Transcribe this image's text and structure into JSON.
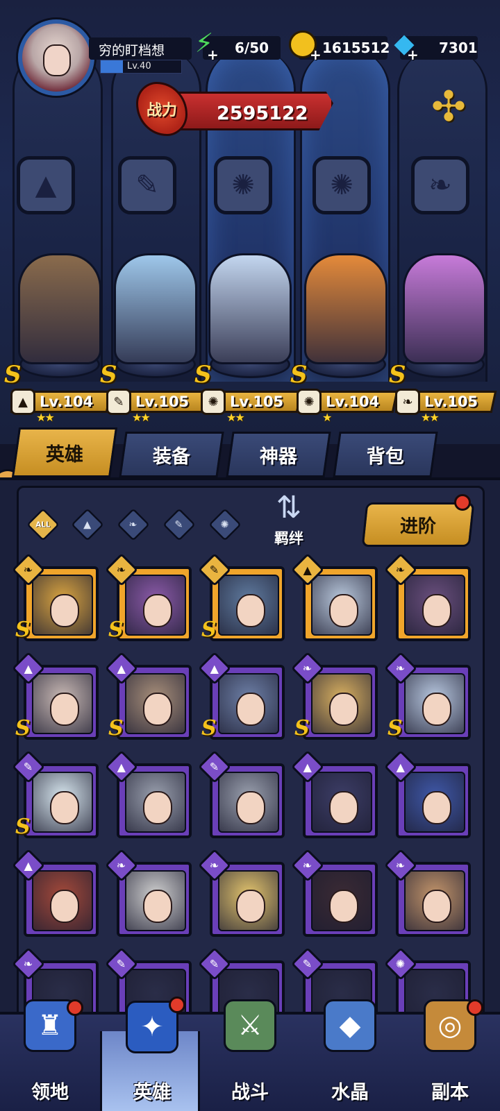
{
  "player": {
    "name": "穷的盯档想",
    "level": "Lv.40",
    "level_progress": 0.28
  },
  "resources": {
    "stamina": "6/50",
    "gold": "1615512",
    "gems": "7301"
  },
  "power": {
    "label": "战力",
    "value": "2595122"
  },
  "lineup": [
    {
      "level": "Lv.104",
      "class_icon": "mage-hat-icon",
      "class_glyph": "▲",
      "stars": "★★",
      "color": "#8a6b4c"
    },
    {
      "level": "Lv.105",
      "class_icon": "wrench-icon",
      "class_glyph": "✎",
      "stars": "★★",
      "color": "#9ec7ea"
    },
    {
      "level": "Lv.105",
      "class_icon": "beast-icon",
      "class_glyph": "✺",
      "stars": "★★",
      "color": "#c3d6ef"
    },
    {
      "level": "Lv.104",
      "class_icon": "beast-icon",
      "class_glyph": "✺",
      "stars": "★",
      "color": "#e48a3a"
    },
    {
      "level": "Lv.105",
      "class_icon": "wing-icon",
      "class_glyph": "❧",
      "stars": "★★",
      "color": "#c77bd9"
    }
  ],
  "tabs": [
    "英雄",
    "装备",
    "神器",
    "背包"
  ],
  "filters": {
    "all_label": "ALL",
    "icons": [
      "mage-hat-icon",
      "wing-icon",
      "wrench-icon",
      "beast-icon"
    ]
  },
  "bond_label": "羁绊",
  "advance_label": "进阶",
  "heroes": [
    {
      "frame": "gold",
      "class": "wing-icon",
      "glyph": "❧",
      "rank": "S",
      "bg": "#d9a441"
    },
    {
      "frame": "gold",
      "class": "wing-icon",
      "glyph": "❧",
      "rank": "S",
      "bg": "#8b5aa8"
    },
    {
      "frame": "gold",
      "class": "wrench-icon",
      "glyph": "✎",
      "rank": "S",
      "bg": "#5f7a9e"
    },
    {
      "frame": "gold",
      "class": "mage-hat-icon",
      "glyph": "▲",
      "rank": "",
      "bg": "#b9c8dc"
    },
    {
      "frame": "gold",
      "class": "wing-icon",
      "glyph": "❧",
      "rank": "",
      "bg": "#6a4f7d"
    },
    {
      "frame": "purple",
      "class": "mage-hat-icon",
      "glyph": "▲",
      "rank": "S",
      "bg": "#c9b9b4"
    },
    {
      "frame": "purple",
      "class": "mage-hat-icon",
      "glyph": "▲",
      "rank": "S",
      "bg": "#a88f7a"
    },
    {
      "frame": "purple",
      "class": "mage-hat-icon",
      "glyph": "▲",
      "rank": "S",
      "bg": "#6d7fa6"
    },
    {
      "frame": "purple",
      "class": "wing-icon",
      "glyph": "❧",
      "rank": "S",
      "bg": "#d9b060"
    },
    {
      "frame": "purple",
      "class": "wing-icon",
      "glyph": "❧",
      "rank": "S",
      "bg": "#b8c8e0"
    },
    {
      "frame": "purple",
      "class": "wrench-icon",
      "glyph": "✎",
      "rank": "S",
      "bg": "#d7e6ee"
    },
    {
      "frame": "purple",
      "class": "mage-hat-icon",
      "glyph": "▲",
      "rank": "",
      "bg": "#9aa0ae"
    },
    {
      "frame": "purple",
      "class": "wrench-icon",
      "glyph": "✎",
      "rank": "",
      "bg": "#9aa0ae"
    },
    {
      "frame": "purple",
      "class": "mage-hat-icon",
      "glyph": "▲",
      "rank": "",
      "bg": "#3c3d66"
    },
    {
      "frame": "purple",
      "class": "mage-hat-icon",
      "glyph": "▲",
      "rank": "",
      "bg": "#3f58a8"
    },
    {
      "frame": "purple",
      "class": "mage-hat-icon",
      "glyph": "▲",
      "rank": "",
      "bg": "#a3493a"
    },
    {
      "frame": "purple",
      "class": "wing-icon",
      "glyph": "❧",
      "rank": "",
      "bg": "#cfcfcf"
    },
    {
      "frame": "purple",
      "class": "wing-icon",
      "glyph": "❧",
      "rank": "",
      "bg": "#e3c46d"
    },
    {
      "frame": "purple",
      "class": "wing-icon",
      "glyph": "❧",
      "rank": "",
      "bg": "#3a2a34"
    },
    {
      "frame": "purple",
      "class": "wing-icon",
      "glyph": "❧",
      "rank": "",
      "bg": "#c2946a"
    },
    {
      "frame": "purple",
      "class": "wing-icon",
      "glyph": "❧",
      "rank": "",
      "bg": "#2a2d48"
    },
    {
      "frame": "purple",
      "class": "wrench-icon",
      "glyph": "✎",
      "rank": "",
      "bg": "#2a2d48"
    },
    {
      "frame": "purple",
      "class": "wrench-icon",
      "glyph": "✎",
      "rank": "",
      "bg": "#2a2d48"
    },
    {
      "frame": "purple",
      "class": "wrench-icon",
      "glyph": "✎",
      "rank": "",
      "bg": "#2a2d48"
    },
    {
      "frame": "purple",
      "class": "beast-icon",
      "glyph": "✺",
      "rank": "",
      "bg": "#2a2d48"
    }
  ],
  "nav": [
    {
      "label": "领地",
      "icon": "castle-icon",
      "glyph": "♜",
      "badge": true,
      "color": "#3a69c9"
    },
    {
      "label": "英雄",
      "icon": "wizard-hat-icon",
      "glyph": "✦",
      "badge": true,
      "color": "#2b5cc0"
    },
    {
      "label": "战斗",
      "icon": "battle-icon",
      "glyph": "⚔",
      "badge": false,
      "color": "#5a8a5a"
    },
    {
      "label": "水晶",
      "icon": "crystal-icon",
      "glyph": "◆",
      "badge": false,
      "color": "#4a7ac9"
    },
    {
      "label": "副本",
      "icon": "portal-icon",
      "glyph": "◎",
      "badge": true,
      "color": "#c58a3a"
    }
  ]
}
